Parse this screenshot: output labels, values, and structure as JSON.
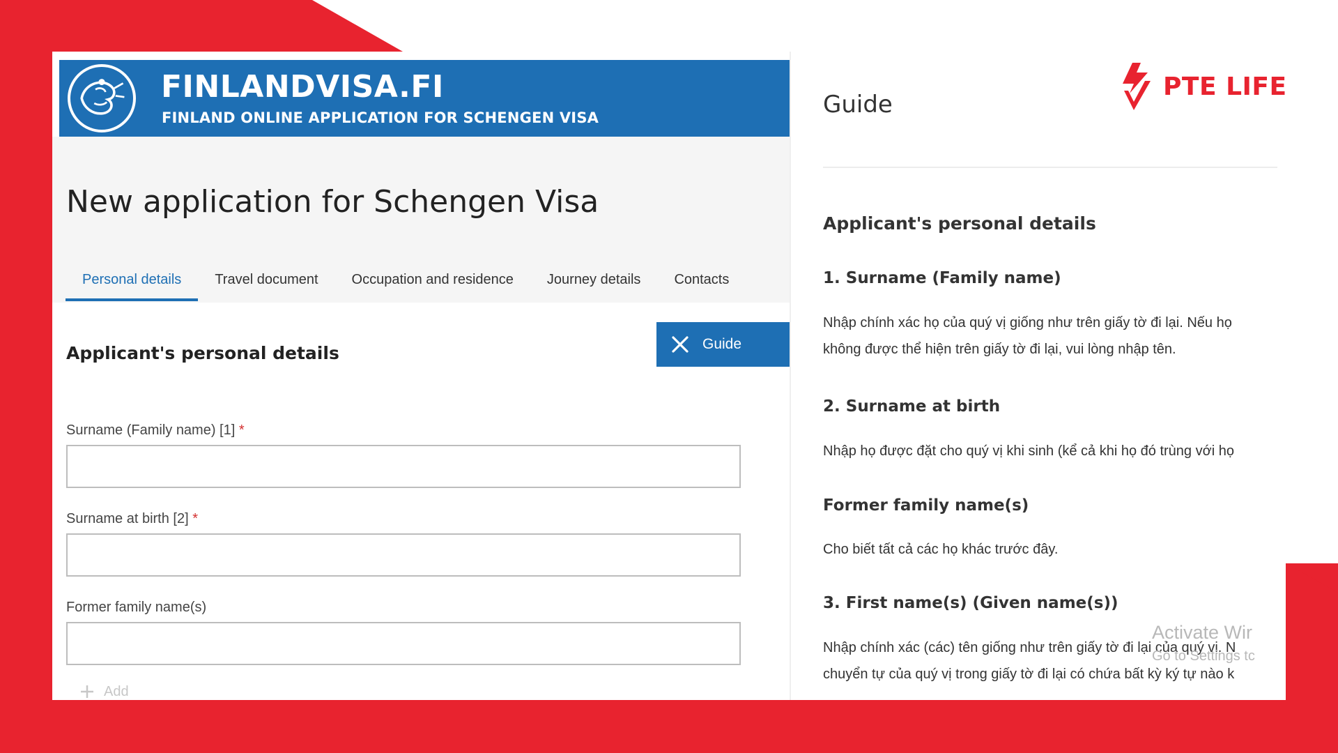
{
  "header": {
    "site_title": "FINLANDVISA.FI",
    "site_subtitle": "FINLAND ONLINE APPLICATION FOR SCHENGEN VISA"
  },
  "page_title": "New application for Schengen Visa",
  "tabs": [
    {
      "label": "Personal details",
      "active": true
    },
    {
      "label": "Travel document",
      "active": false
    },
    {
      "label": "Occupation and residence",
      "active": false
    },
    {
      "label": "Journey details",
      "active": false
    },
    {
      "label": "Contacts",
      "active": false
    }
  ],
  "guide_button": {
    "label": "Guide"
  },
  "form": {
    "section_title": "Applicant's personal details",
    "fields": [
      {
        "label": "Surname (Family name) [1]",
        "required_mark": "*",
        "value": ""
      },
      {
        "label": "Surname at birth [2]",
        "required_mark": "*",
        "value": ""
      },
      {
        "label": "Former family name(s)",
        "required_mark": "",
        "value": ""
      }
    ],
    "add_label": "Add"
  },
  "guide": {
    "title": "Guide",
    "logo_text": "PTE LIFE",
    "section_title": "Applicant's personal details",
    "items": [
      {
        "heading": "1. Surname (Family name)",
        "lines": [
          "Nhập chính xác họ của quý vị giống như trên giấy tờ đi lại. Nếu họ",
          "không được thể hiện trên giấy tờ đi lại, vui lòng nhập tên."
        ]
      },
      {
        "heading": "2. Surname at birth",
        "lines": [
          "Nhập họ được đặt cho quý vị khi sinh (kể cả khi họ đó trùng với họ"
        ]
      },
      {
        "heading": "Former family name(s)",
        "lines": [
          "Cho biết tất cả các họ khác trước đây."
        ]
      },
      {
        "heading": "3. First name(s) (Given name(s))",
        "lines": [
          "Nhập chính xác (các) tên giống như trên giấy tờ đi lại của quý vị. N",
          "chuyển tự của quý vị trong giấy tờ đi lại có chứa bất kỳ ký tự nào k"
        ]
      }
    ]
  },
  "watermark": {
    "line1": "Activate Wir",
    "line2": "Go to Settings tc"
  },
  "colors": {
    "brand_blue": "#1e6fb4",
    "accent_red": "#e8232f",
    "required_red": "#d32f2f"
  }
}
